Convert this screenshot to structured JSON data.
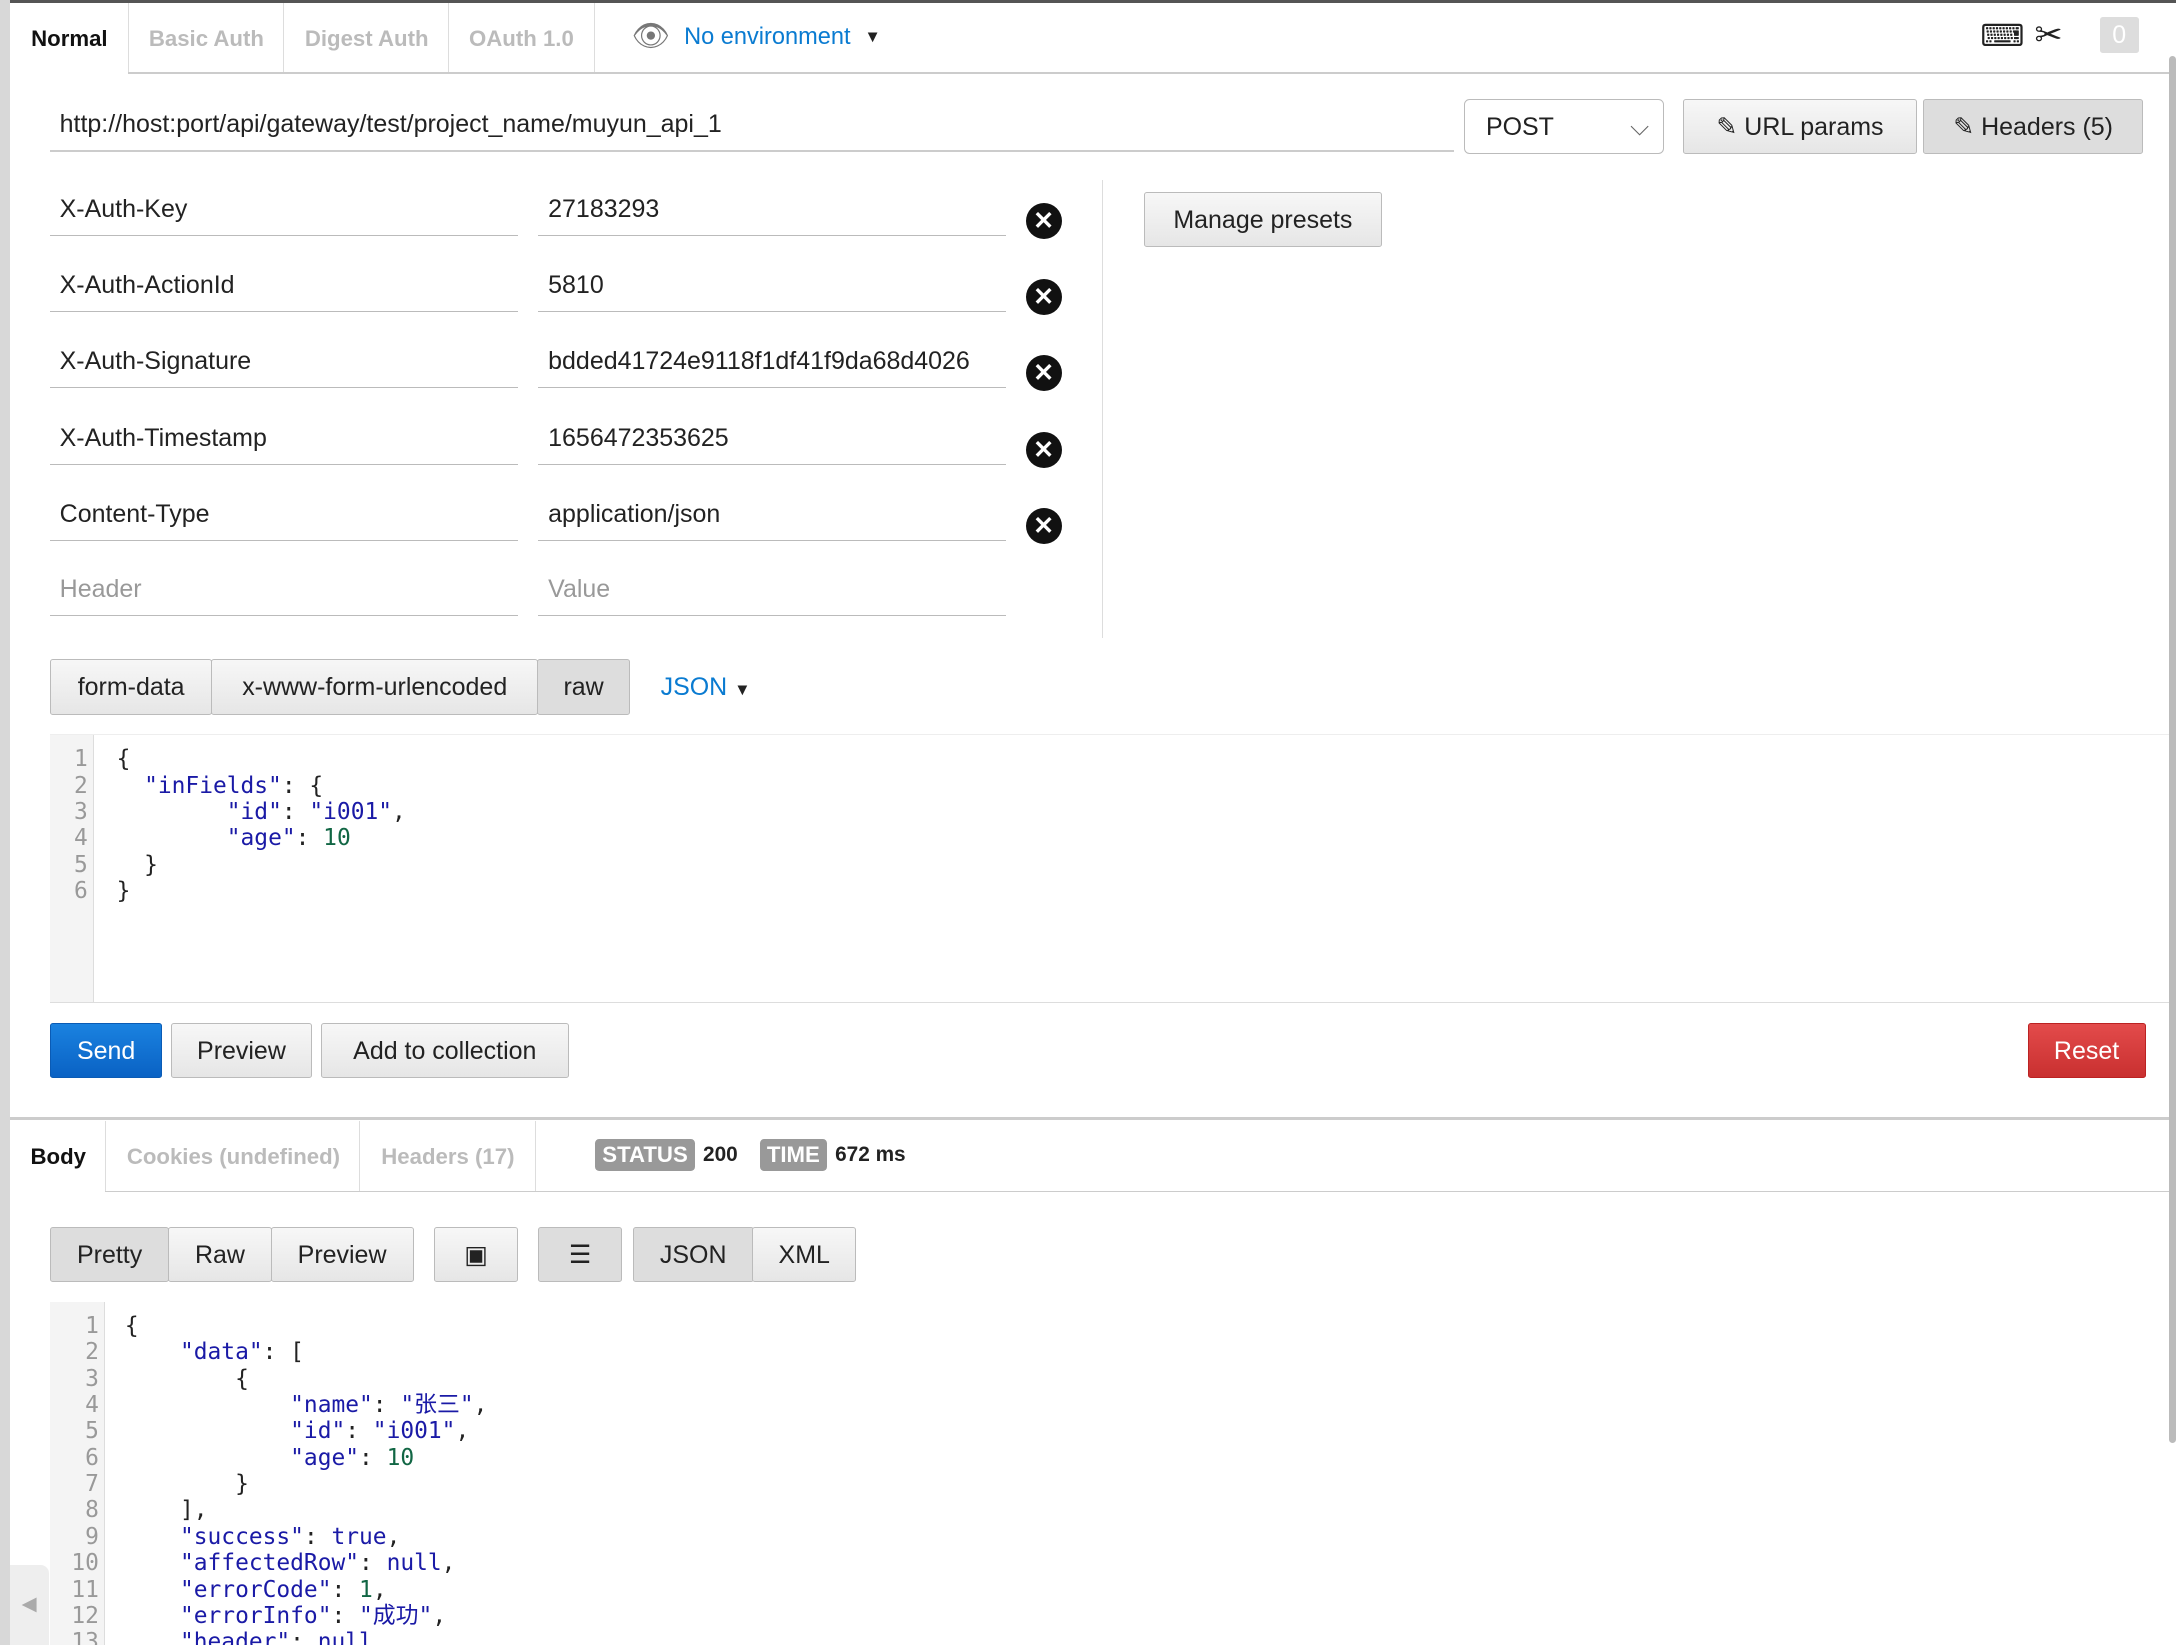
{
  "tabs": [
    "Normal",
    "Basic Auth",
    "Digest Auth",
    "OAuth 1.0"
  ],
  "environment": "No environment",
  "counter": "0",
  "url": "http://host:port/api/gateway/test/project_name/muyun_api_1",
  "method": "POST",
  "url_params_label": "URL params",
  "headers_button_label": "Headers (5)",
  "manage_presets": "Manage presets",
  "headers": [
    {
      "key": "X-Auth-Key",
      "value": "27183293"
    },
    {
      "key": "X-Auth-ActionId",
      "value": "5810"
    },
    {
      "key": "X-Auth-Signature",
      "value": "bdded41724e9118f1df41f9da68d4026"
    },
    {
      "key": "X-Auth-Timestamp",
      "value": "1656472353625"
    },
    {
      "key": "Content-Type",
      "value": "application/json"
    }
  ],
  "header_placeholder": "Header",
  "value_placeholder": "Value",
  "body_types": [
    "form-data",
    "x-www-form-urlencoded",
    "raw"
  ],
  "raw_format": "JSON",
  "request_body": "{\n  \"inFields\": {\n        \"id\": \"i001\",\n        \"age\": 10\n  }\n}",
  "actions": {
    "send": "Send",
    "preview": "Preview",
    "add": "Add to collection",
    "reset": "Reset"
  },
  "response_tabs": [
    "Body",
    "Cookies (undefined)",
    "Headers (17)"
  ],
  "status_label": "STATUS",
  "status": "200",
  "time_label": "TIME",
  "time": "672 ms",
  "view_modes": [
    "Pretty",
    "Raw",
    "Preview"
  ],
  "formats": [
    "JSON",
    "XML"
  ],
  "response_body": "{\n    \"data\": [\n        {\n            \"name\": \"张三\",\n            \"id\": \"i001\",\n            \"age\": 10\n        }\n    ],\n    \"success\": true,\n    \"affectedRow\": null,\n    \"errorCode\": 1,\n    \"errorInfo\": \"成功\",\n    \"header\": null,",
  "colors": {
    "send": "#0a6fd1",
    "reset": "#d23a3a",
    "link": "#0a7bd1"
  }
}
